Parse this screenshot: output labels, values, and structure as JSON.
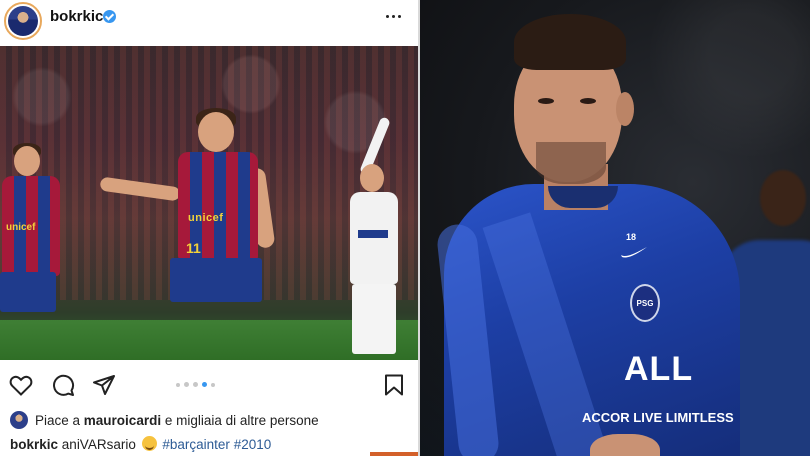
{
  "post": {
    "username": "bokrkic",
    "likes": {
      "prefix": "Piace a",
      "liked_by": "mauroicardi",
      "suffix": "e migliaia di altre persone"
    },
    "caption": {
      "author": "bokrkic",
      "text": "aniVARsario",
      "hashtag_1": "#barçainter",
      "hashtag_2": "#2010"
    },
    "photo": {
      "shirt_sponsor": "unicef",
      "shirt_number": "11"
    },
    "carousel": {
      "count": 5,
      "active_index": 3
    },
    "icons": {
      "verified": "verified-badge-icon",
      "more": "more-options-icon",
      "like": "heart-icon",
      "comment": "comment-icon",
      "share": "share-icon",
      "save": "bookmark-icon"
    }
  },
  "right_photo": {
    "shirt_number": "18",
    "crest": "PSG",
    "sponsor_main": "ALL",
    "sponsor_sub": "ACCOR LIVE LIMITLESS"
  },
  "colors": {
    "instagram_blue": "#3897f0",
    "hashtag": "#2d5b95",
    "barca_blue": "#1f3b8c",
    "barca_red": "#a6193a",
    "psg_blue": "#1d3fa5"
  }
}
